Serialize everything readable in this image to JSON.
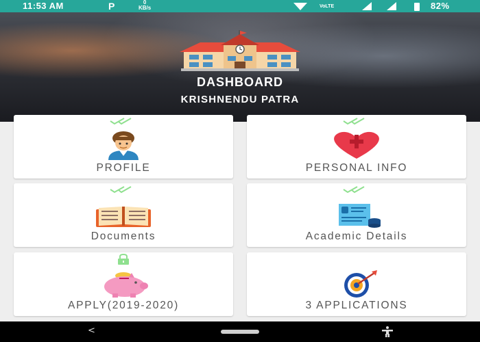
{
  "status_bar": {
    "time": "11:53 AM",
    "app_icon": "P",
    "speed_value": "0",
    "speed_unit": "KB/s",
    "icons": [
      "notification-icon",
      "wifi-icon",
      "volte-icon",
      "signal-icon",
      "signal-icon",
      "battery-icon"
    ],
    "battery": "82%"
  },
  "header": {
    "title": "DASHBOARD",
    "subtitle": "KRISHNENDU PATRA"
  },
  "cards": [
    {
      "label": "PROFILE",
      "icon": "profile-avatar-icon",
      "status": "check"
    },
    {
      "label": "PERSONAL INFO",
      "icon": "heart-icon",
      "status": "check"
    },
    {
      "label": "Documents",
      "icon": "book-icon",
      "status": "check"
    },
    {
      "label": "Academic Details",
      "icon": "academic-certificate-icon",
      "status": "check"
    },
    {
      "label": "APPLY(2019-2020)",
      "icon": "piggy-bank-icon",
      "status": "lock"
    },
    {
      "label": "3 APPLICATIONS",
      "icon": "target-icon",
      "status": "none"
    }
  ],
  "nav_bar": {
    "back": "<",
    "icons": [
      "back-icon",
      "home-pill",
      "accessibility-icon"
    ]
  },
  "colors": {
    "status_bar": "#27a79a",
    "check": "#8fe08f",
    "card_text": "#555555",
    "background": "#eeeeee"
  }
}
